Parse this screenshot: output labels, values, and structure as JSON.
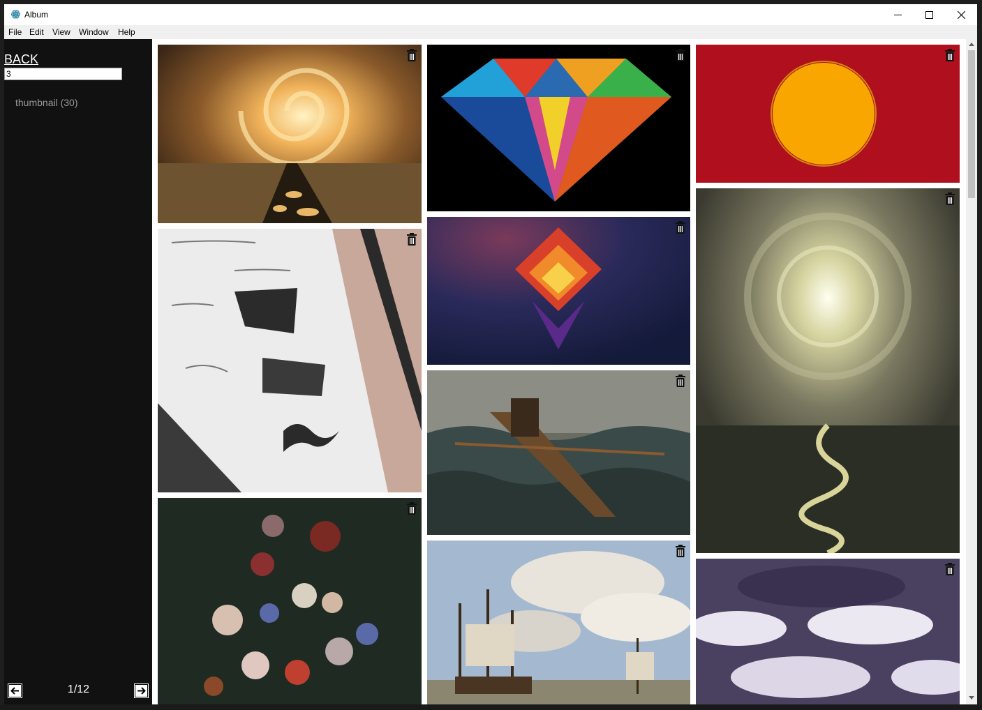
{
  "window": {
    "title": "Album",
    "controls": [
      "minimize-icon",
      "maximize-icon",
      "close-icon"
    ]
  },
  "menu": [
    "File",
    "Edit",
    "View",
    "Window",
    "Help"
  ],
  "sidebar": {
    "back_label": "BACK",
    "search_value": "3",
    "folders": [
      {
        "label": "thumbnail (30)"
      }
    ]
  },
  "pagination": {
    "current": "1/12",
    "prev_icon": "arrow-left-icon",
    "next_icon": "arrow-right-icon"
  },
  "gallery": {
    "delete_icon": "trash-icon",
    "columns": [
      {
        "images": [
          {
            "name": "surreal-vortex-road",
            "accent": "#c8782a"
          },
          {
            "name": "logo-sketch-notebook",
            "accent": "#e8e8e8"
          },
          {
            "name": "flower-still-life",
            "accent": "#2b3a2d"
          }
        ]
      },
      {
        "images": [
          {
            "name": "polygon-diamond",
            "accent": "#000000"
          },
          {
            "name": "geometric-flame-shape",
            "accent": "#1f2550"
          },
          {
            "name": "rowboat-stormy-sea",
            "accent": "#5d6058"
          },
          {
            "name": "sailing-ships",
            "accent": "#8fa8c6"
          }
        ]
      },
      {
        "images": [
          {
            "name": "orange-circle-on-red",
            "accent": "#b0101d"
          },
          {
            "name": "cloud-vortex-river",
            "accent": "#5b5a46"
          },
          {
            "name": "purple-cloudscape",
            "accent": "#5a5370"
          }
        ]
      }
    ]
  }
}
